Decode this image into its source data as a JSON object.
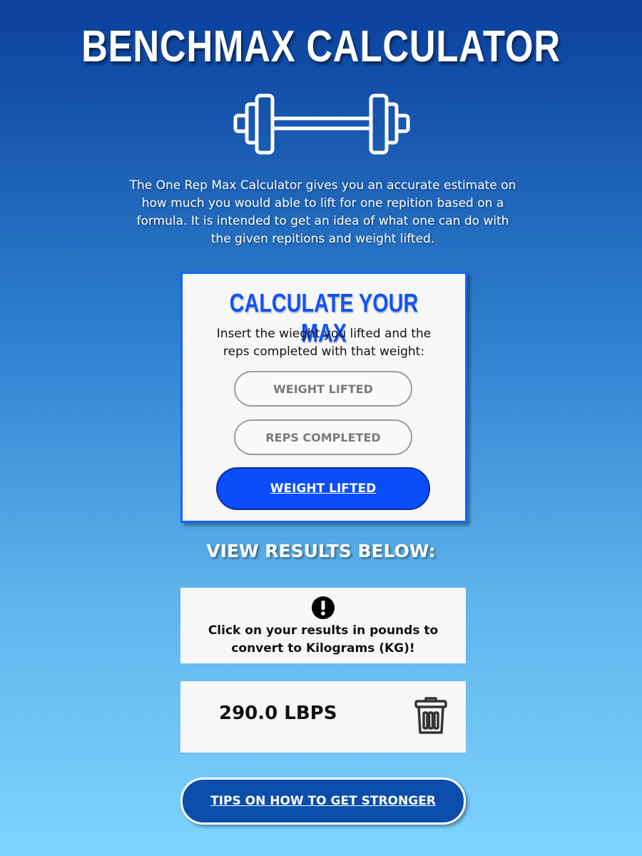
{
  "header": {
    "title": "BENCHMAX CALCULATOR",
    "logo_icon": "barbell-icon",
    "intro": "The One Rep Max Calculator gives you an accurate estimate on how much you would able to lift for one repition based on a formula. It is intended to get an idea of what one can do with the given repitions and weight lifted."
  },
  "calculator": {
    "title": "CALCULATE YOUR MAX",
    "instructions": "Insert the wieght you lifted and the reps completed with that weight:",
    "weight_placeholder": "WEIGHT LIFTED",
    "reps_placeholder": "REPS COMPLETED",
    "submit_label": "WEIGHT LIFTED"
  },
  "results": {
    "heading": "VIEW RESULTS BELOW:",
    "notice_icon": "exclamation-icon",
    "notice_text": "Click on your results in pounds to convert to Kilograms (KG)!",
    "value": "290.0 LBPS",
    "delete_icon": "trash-icon"
  },
  "footer": {
    "tips_label": "TIPS ON HOW TO GET STRONGER"
  },
  "colors": {
    "accent": "#0a4dfb",
    "title_blue": "#1052f5",
    "tips_button": "#0a4dab",
    "card_bg": "#f7f7f7"
  }
}
